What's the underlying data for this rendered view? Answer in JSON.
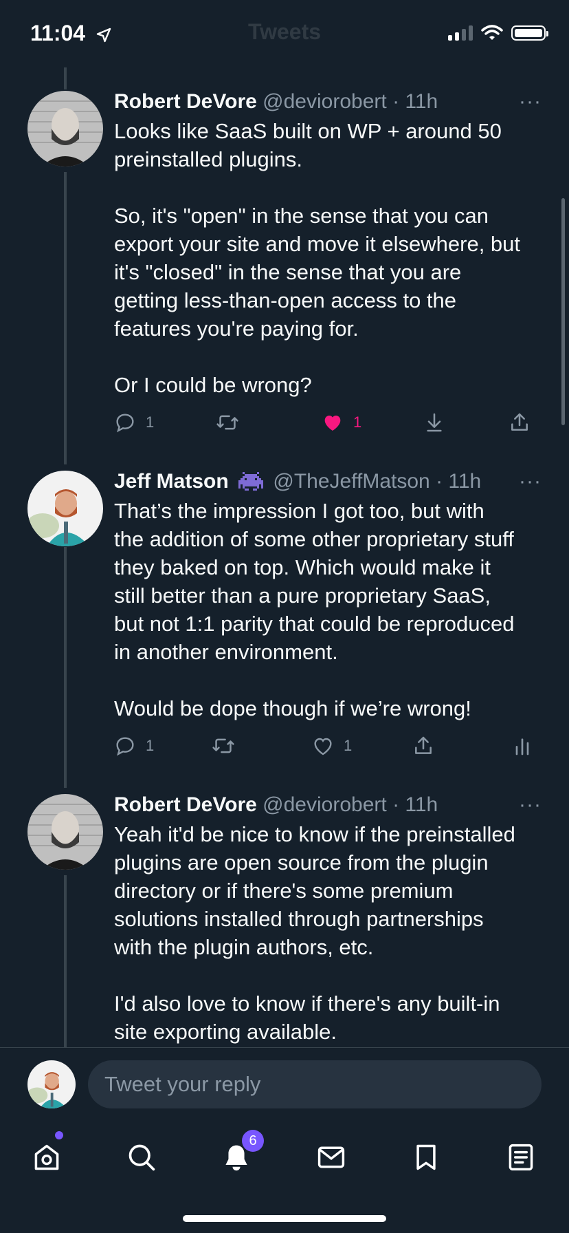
{
  "status_bar": {
    "time": "11:04",
    "ghost_title": "Tweets"
  },
  "tweets": [
    {
      "name": "Robert DeVore",
      "handle": "@deviorobert",
      "time_ago": "11h",
      "text": "Looks like SaaS built on WP + around 50\npreinstalled plugins.\n\nSo, it's \"open\" in the sense that you can\nexport your site and move it elsewhere, but\nit's \"closed\" in the sense that you are\ngetting less-than-open access to the\nfeatures you're paying for.\n\nOr I could be wrong?",
      "replies": "1",
      "likes": "1",
      "liked": true
    },
    {
      "name": "Jeff Matson",
      "handle": "@TheJeffMatson",
      "time_ago": "11h",
      "text": "That’s the impression I got too, but with\nthe addition of some other proprietary stuff\nthey baked on top. Which would make it\nstill better than a pure proprietary SaaS,\nbut not 1:1 parity that could be reproduced\nin another environment.\n\nWould be dope though if we’re wrong!",
      "replies": "1",
      "likes": "1",
      "liked": false
    },
    {
      "name": "Robert DeVore",
      "handle": "@deviorobert",
      "time_ago": "11h",
      "text": "Yeah it'd be nice to know if the preinstalled\nplugins are open source from the plugin\ndirectory or if there's some premium\nsolutions installed through partnerships\nwith the plugin authors, etc.\n\nI'd also love to know if there's any built-in\nsite exporting available."
    }
  ],
  "separator": "·",
  "more_glyph": "···",
  "composer": {
    "placeholder": "Tweet your reply"
  },
  "tab_bar": {
    "notifications_badge": "6"
  },
  "colors": {
    "background": "#15202b",
    "like": "#f91880",
    "badge": "#7856ff",
    "muted": "#8b98a5"
  },
  "icons": [
    "home-icon",
    "search-icon",
    "notifications-icon",
    "messages-icon",
    "bookmarks-icon",
    "lists-icon",
    "reply-icon",
    "retweet-icon",
    "like-icon",
    "bookmark-down-icon",
    "share-icon",
    "analytics-icon"
  ]
}
